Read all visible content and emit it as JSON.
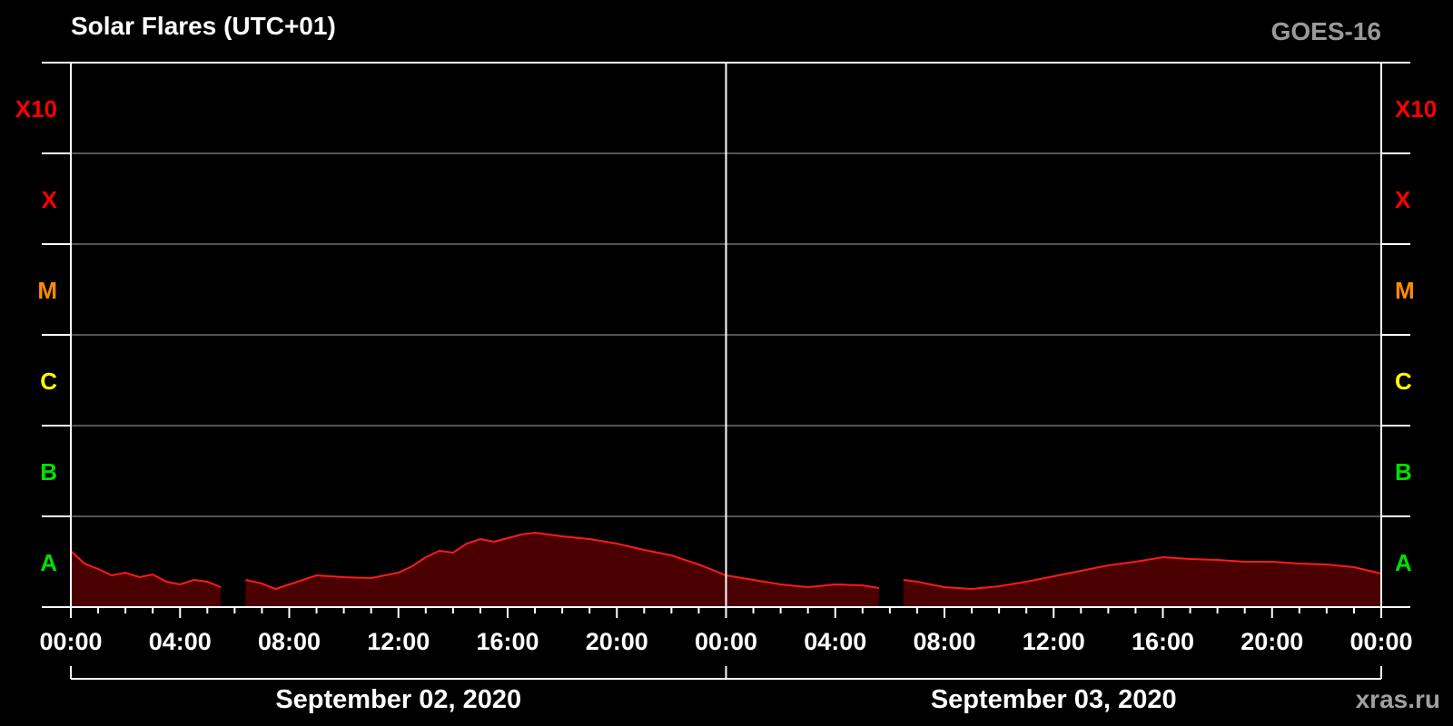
{
  "header": {
    "title": "Solar Flares (UTC+01)",
    "satellite": "GOES-16",
    "credit": "xras.ru"
  },
  "colors": {
    "background": "#000000",
    "axis": "#ffffff",
    "grid": "#555555",
    "line": "#ff1a1a",
    "fill": "#4a0000",
    "A": "#00e000",
    "B": "#00e000",
    "C": "#ffff00",
    "M": "#ff8c00",
    "X": "#ff0000",
    "X10": "#ff0000"
  },
  "chart_data": {
    "type": "area",
    "title": "Solar Flares (UTC+01)",
    "y_scale": "log",
    "y_classes": [
      "A",
      "B",
      "C",
      "M",
      "X",
      "X10"
    ],
    "ylim_class_index": [
      0,
      6
    ],
    "x_tick_labels": [
      "00:00",
      "04:00",
      "08:00",
      "12:00",
      "16:00",
      "20:00",
      "00:00",
      "04:00",
      "08:00",
      "12:00",
      "16:00",
      "20:00",
      "00:00"
    ],
    "xlim_hours": [
      0,
      48
    ],
    "dates": [
      "September 02, 2020",
      "September 03, 2020"
    ],
    "grid": true,
    "series": [
      {
        "x_hours": [
          0,
          0.5,
          1,
          1.5,
          2,
          2.5,
          3,
          3.5,
          4,
          4.5,
          5,
          5.5,
          null,
          6.4,
          7,
          7.5,
          8,
          9,
          10,
          11,
          12,
          12.5,
          13,
          13.5,
          14,
          14.5,
          15,
          15.5,
          16,
          16.5,
          17,
          17.5,
          18,
          19,
          20,
          21,
          22,
          23,
          24,
          25,
          26,
          27,
          28,
          29,
          29.6,
          null,
          30.5,
          31,
          32,
          33,
          34,
          35,
          36,
          37,
          38,
          39,
          40,
          41,
          42,
          43,
          44,
          45,
          46,
          47,
          48
        ],
        "y_class_index": [
          0.62,
          0.48,
          0.42,
          0.35,
          0.38,
          0.33,
          0.36,
          0.28,
          0.25,
          0.3,
          0.28,
          0.22,
          null,
          0.3,
          0.26,
          0.2,
          0.25,
          0.35,
          0.33,
          0.32,
          0.38,
          0.45,
          0.55,
          0.62,
          0.6,
          0.7,
          0.75,
          0.72,
          0.76,
          0.8,
          0.82,
          0.8,
          0.78,
          0.75,
          0.7,
          0.63,
          0.57,
          0.47,
          0.35,
          0.3,
          0.25,
          0.22,
          0.25,
          0.24,
          0.21,
          null,
          0.3,
          0.28,
          0.22,
          0.2,
          0.23,
          0.28,
          0.34,
          0.4,
          0.46,
          0.5,
          0.55,
          0.53,
          0.52,
          0.5,
          0.5,
          0.48,
          0.47,
          0.44,
          0.37
        ]
      }
    ]
  }
}
